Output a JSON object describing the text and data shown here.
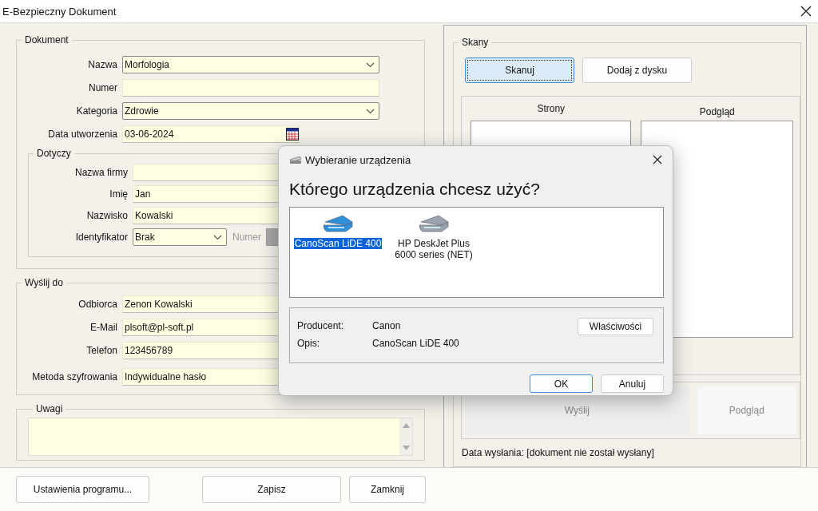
{
  "window": {
    "title": "E-Bezpieczny Dokument"
  },
  "document": {
    "legend": "Dokument",
    "fields": [
      {
        "label": "Nazwa",
        "value": "Morfologia",
        "kind": "combo"
      },
      {
        "label": "Numer",
        "kind": "text"
      },
      {
        "label": "Kategoria",
        "value": "Zdrowie",
        "kind": "combo"
      },
      {
        "label": "Data utworzenia",
        "value": "03-06-2024",
        "kind": "date"
      }
    ]
  },
  "concerns": {
    "legend": "Dotyczy",
    "fields": [
      {
        "label": "Nazwa firmy",
        "kind": "text"
      },
      {
        "label": "Imię",
        "value": "Jan",
        "kind": "text"
      },
      {
        "label": "Nazwisko",
        "value": "Kowalski",
        "kind": "text"
      },
      {
        "label": "Identyfikator",
        "value": "Brak",
        "kind": "id-combo",
        "number_label": "Numer",
        "number_disabled": true
      }
    ]
  },
  "send_to": {
    "legend": "Wyślij do",
    "fields": [
      {
        "label": "Odbiorca",
        "value": "Zenon Kowalski",
        "kind": "text"
      },
      {
        "label": "E-Mail",
        "value": "plsoft@pl-soft.pl",
        "kind": "text"
      },
      {
        "label": "Telefon",
        "value": "123456789",
        "kind": "text"
      },
      {
        "label": "Metoda szyfrowania",
        "value": "Indywidualne hasło",
        "kind": "text"
      }
    ]
  },
  "notes": {
    "legend": "Uwagi"
  },
  "footer_buttons": [
    {
      "label": "Ustawienia programu..."
    },
    {
      "label": "Zapisz"
    },
    {
      "label": "Zamknij"
    }
  ],
  "scans": {
    "legend": "Skany",
    "buttons": [
      {
        "label": "Skanuj",
        "selected": true
      },
      {
        "label": "Dodaj z dysku",
        "selected": false
      }
    ],
    "pages_label": "Strony",
    "preview_label": "Podgląd",
    "actions": [
      {
        "label": "Wyślij",
        "disabled": true
      },
      {
        "label": "Podgląd",
        "disabled": true
      }
    ],
    "sent_date": "Data wysłania: [dokument nie został wysłany]"
  },
  "dialog": {
    "title": "Wybieranie urządzenia",
    "question": "Którego urządzenia chcesz użyć?",
    "devices": [
      {
        "name": "CanoScan LiDE 400",
        "selected": true,
        "color": "#2f8fd8"
      },
      {
        "name": "HP DeskJet Plus 6000 series (NET)",
        "selected": false,
        "color": "#9aa3ad"
      }
    ],
    "details": [
      {
        "label": "Producent:",
        "value": "Canon"
      },
      {
        "label": "Opis:",
        "value": "CanoScan LiDE 400"
      }
    ],
    "properties_button": "Właściwości",
    "buttons": [
      {
        "label": "OK",
        "default": true
      },
      {
        "label": "Anuluj",
        "default": false
      }
    ]
  }
}
